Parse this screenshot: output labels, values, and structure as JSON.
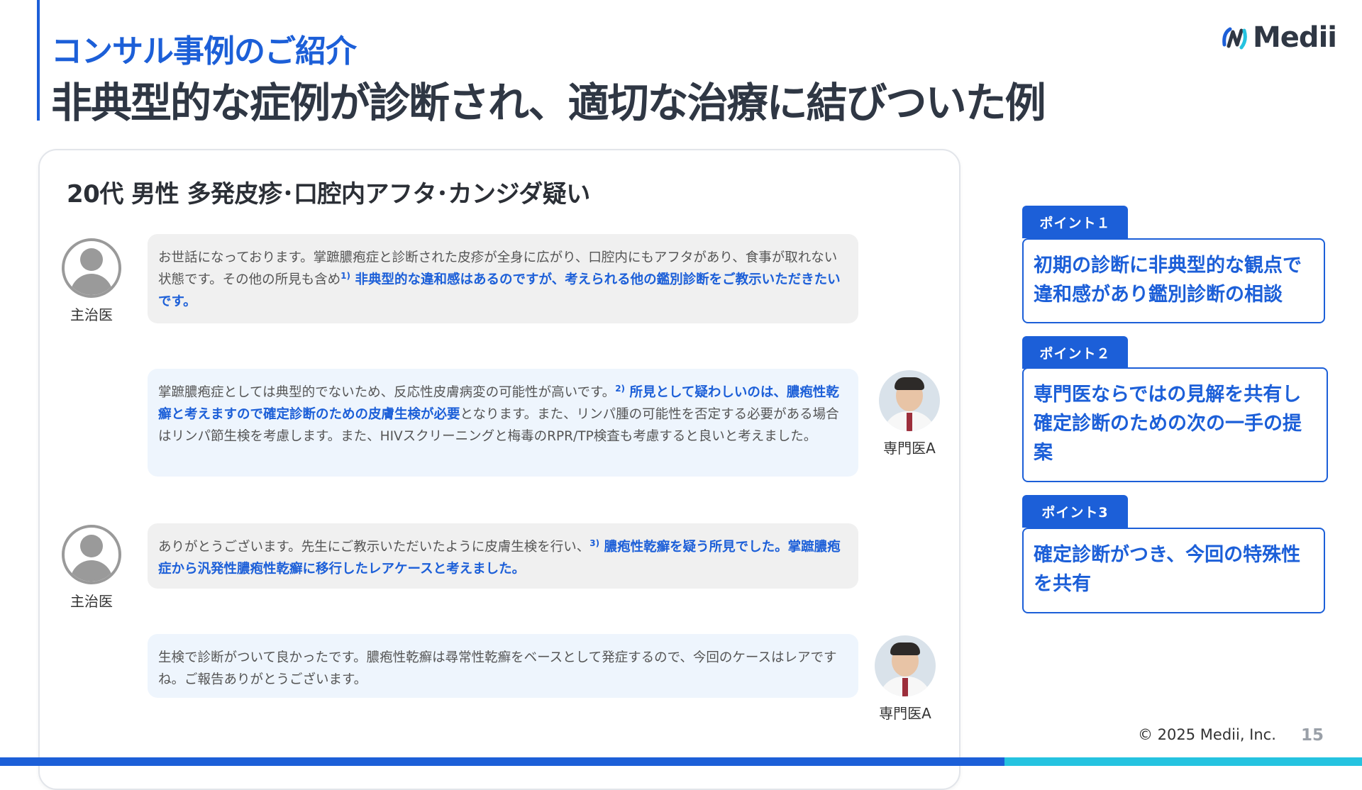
{
  "header": {
    "subtitle": "コンサル事例のご紹介",
    "title": "非典型的な症例が診断され、適切な治療に結びついた例"
  },
  "logo": {
    "text": "Medii",
    "icon": "medii-logo-icon"
  },
  "case": {
    "title": "20代 男性 多発皮疹･口腔内アフタ･カンジダ疑い",
    "messages": [
      {
        "speaker": "主治医",
        "avatar": "user-silhouette-icon",
        "text_a": "お世話になっております。掌蹠膿疱症と診断された皮疹が全身に広がり、口腔内にもアフタがあり、食事が取れない状態です。その他の所見も含め",
        "sup": "1)",
        "highlight": " 非典型的な違和感はあるのですが、考えられる他の鑑別診断をご教示いただきたいです。"
      },
      {
        "speaker": "専門医A",
        "avatar": "doctor-photo",
        "text_a": "掌蹠膿疱症としては典型的でないため、反応性皮膚病変の可能性が高いです。",
        "sup": "2)",
        "highlight": " 所見として疑わしいのは、膿疱性乾癬と考えますので確定診断のための皮膚生検が必要",
        "text_b": "となります。また、リンパ腫の可能性を否定する必要がある場合はリンパ節生検を考慮します。また、HIVスクリーニングと梅毒のRPR/TP検査も考慮すると良いと考えました。"
      },
      {
        "speaker": "主治医",
        "avatar": "user-silhouette-icon",
        "text_a": "ありがとうございます。先生にご教示いただいたように皮膚生検を行い、",
        "sup": "3)",
        "highlight": " 膿疱性乾癬を疑う所見でした。掌蹠膿疱症から汎発性膿疱性乾癬に移行したレアケースと考えました。"
      },
      {
        "speaker": "専門医A",
        "avatar": "doctor-photo",
        "text_a": "生検で診断がついて良かったです。膿疱性乾癬は尋常性乾癬をベースとして発症するので、今回のケースはレアですね。ご報告ありがとうございます。"
      }
    ]
  },
  "points": [
    {
      "label": "ポイント１",
      "text": "初期の診断に非典型的な観点で違和感があり鑑別診断の相談"
    },
    {
      "label": "ポイント２",
      "text": "専門医ならではの見解を共有し確定診断のための次の一手の提案"
    },
    {
      "label": "ポイント3",
      "text": "確定診断がつき、今回の特殊性を共有"
    }
  ],
  "footer": {
    "copyright": "© 2025 Medii, Inc.",
    "page": "15"
  },
  "colors": {
    "accent": "#1c5fd8",
    "accent2": "#25c3e0",
    "bubble_gray": "#f0f0f0",
    "bubble_blue": "#eef5fd"
  }
}
